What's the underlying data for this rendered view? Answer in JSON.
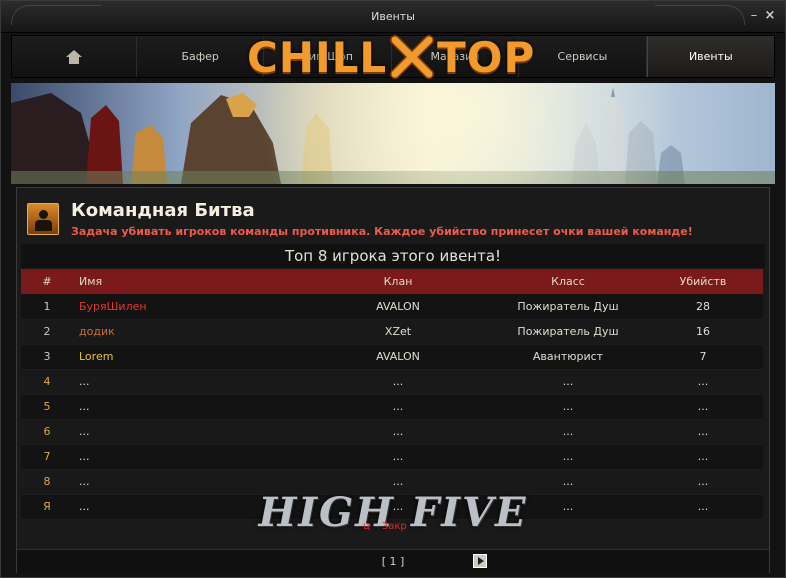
{
  "window": {
    "title": "Ивенты",
    "minimize": "–",
    "close": "×"
  },
  "nav": {
    "items": [
      {
        "label": "",
        "icon": "home-icon"
      },
      {
        "label": "Бафер"
      },
      {
        "label": "Гип-Шоп"
      },
      {
        "label": "Магазин"
      },
      {
        "label": "Сервисы"
      },
      {
        "label": "Ивенты",
        "active": true
      }
    ]
  },
  "logo": {
    "left": "CHILL",
    "right": "TOP",
    "color": "#f29a2e"
  },
  "event": {
    "title": "Командная Битва",
    "description": "Задача убивать игроков команды противника. Каждое убийство принесет очки вашей команде!",
    "top_caption": "Топ 8 игрока этого ивента!"
  },
  "table": {
    "headers": {
      "rank": "#",
      "name": "Имя",
      "clan": "Клан",
      "class": "Класс",
      "kills": "Убийств"
    },
    "rows": [
      {
        "rank": "1",
        "name": "БуряШилен",
        "clan": "AVALON",
        "class": "Пожиратель Душ",
        "kills": "28"
      },
      {
        "rank": "2",
        "name": "додик",
        "clan": "XZet",
        "class": "Пожиратель Душ",
        "kills": "16"
      },
      {
        "rank": "3",
        "name": "Lorem",
        "clan": "AVALON",
        "class": "Авантюрист",
        "kills": "7"
      },
      {
        "rank": "4",
        "name": "...",
        "clan": "...",
        "class": "...",
        "kills": "..."
      },
      {
        "rank": "5",
        "name": "...",
        "clan": "...",
        "class": "...",
        "kills": "..."
      },
      {
        "rank": "6",
        "name": "...",
        "clan": "...",
        "class": "...",
        "kills": "..."
      },
      {
        "rank": "7",
        "name": "...",
        "clan": "...",
        "class": "...",
        "kills": "..."
      },
      {
        "rank": "8",
        "name": "...",
        "clan": "...",
        "class": "...",
        "kills": "..."
      },
      {
        "rank": "Я",
        "name": "...",
        "clan": "...",
        "class": "...",
        "kills": "..."
      }
    ]
  },
  "watermark": {
    "text": "HIGH FIVE"
  },
  "close_text": {
    "part1": "ц",
    "part2": "Закр"
  },
  "pager": {
    "page": "[ 1 ]"
  },
  "colors": {
    "header_row": "#7a1a1a",
    "rank1": "#e03a2a",
    "rank2": "#c9703a",
    "rank3": "#e8c24a",
    "accent": "#ef5a4b"
  }
}
